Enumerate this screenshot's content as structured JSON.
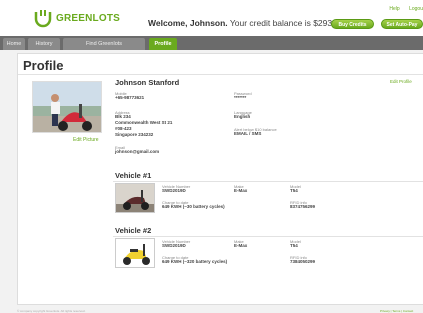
{
  "header": {
    "logo_text": "GREENLOTS",
    "welcome_prefix": "Welcome, Johnson.",
    "welcome_suffix": " Your credit balance is $293.08",
    "help_label": "Help",
    "logout_label": "Logou",
    "buy_credits_label": "Buy Credits",
    "set_autopay_label": "Set Auto-Pay"
  },
  "nav": {
    "tabs": [
      {
        "label": "Home",
        "active": false
      },
      {
        "label": "History",
        "active": false
      },
      {
        "label": "Find Greenlots",
        "active": false
      },
      {
        "label": "Profile",
        "active": true
      }
    ]
  },
  "page": {
    "title": "Profile",
    "edit_picture_label": "Edit Picture",
    "edit_profile_label": "Edit Profile"
  },
  "profile": {
    "name": "Johnson Stanford",
    "mobile_label": "Mobile",
    "mobile_value": "+65-98773621",
    "password_label": "Password",
    "password_value": "*******",
    "address_label": "Address",
    "address_lines": [
      "Blk 234",
      "Commonwealth West St 21",
      "#08-423",
      "Singapore 234232"
    ],
    "language_label": "Language",
    "language_value": "English",
    "alert_label": "Alert below $10 balance",
    "alert_value": "EMAIL / SMS",
    "email_label": "Email",
    "email_value": "johnson@gmail.com"
  },
  "vehicles": [
    {
      "title": "Vehicle #1",
      "number_label": "Vehicle Number",
      "number_value": "SWD2019D",
      "make_label": "Make",
      "make_value": "E-Max",
      "model_label": "Model",
      "model_value": "T54",
      "charge_label": "Charge to date",
      "charge_value": "649 KWH (~30 battery cycles)",
      "rfid_label": "RFID info",
      "rfid_value": "8374756299"
    },
    {
      "title": "Vehicle #2",
      "number_label": "Vehicle Number",
      "number_value": "SWD2019D",
      "make_label": "Make",
      "make_value": "E-Max",
      "model_label": "Model",
      "model_value": "T54",
      "charge_label": "Charge to date",
      "charge_value": "649 KWH (~320 battery cycles)",
      "rfid_label": "RFID info",
      "rfid_value": "7384050299"
    }
  ],
  "footer": {
    "copyright": "© company copyright Greenlots. All rights reserved.",
    "right_link": "Privacy | Terms | Contact"
  },
  "colors": {
    "brand_green": "#6aaa1e",
    "nav_bg": "#6b6b6b",
    "page_bg": "#f2f2f2"
  }
}
